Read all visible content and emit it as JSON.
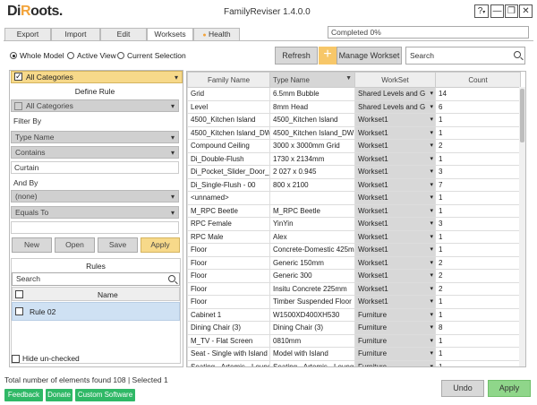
{
  "app": {
    "logo": "DiRoots",
    "title": "FamilyReviser 1.4.0.0"
  },
  "window_controls": {
    "help": "?",
    "minimize": "—",
    "restore": "❐",
    "close": "✕"
  },
  "tabs": [
    {
      "label": "Export"
    },
    {
      "label": "Import"
    },
    {
      "label": "Edit"
    },
    {
      "label": "Worksets"
    },
    {
      "label": "Health"
    }
  ],
  "progress": {
    "text": "Completed 0%",
    "value": 0
  },
  "scope": {
    "options": [
      "Whole Model",
      "Active View",
      "Current Selection"
    ],
    "selected": "Whole Model"
  },
  "toolbar": {
    "refresh": "Refresh",
    "manage_workset": "Manage Workset",
    "search_placeholder": "Search"
  },
  "left": {
    "category_filter": "All Categories",
    "define_rule_title": "Define Rule",
    "rule_category": "All Categories",
    "filter_by_label": "Filter By",
    "filter_by_value": "Type Name",
    "operator_value": "Contains",
    "filter_text": "Curtain",
    "and_by_label": "And By",
    "and_by_value": "(none)",
    "operator2_value": "Equals To",
    "buttons": {
      "new": "New",
      "open": "Open",
      "save": "Save",
      "apply": "Apply"
    },
    "rules_title": "Rules",
    "rules_search_placeholder": "Search",
    "rules_name_header": "Name",
    "rules": [
      {
        "name": "Rule 02"
      }
    ],
    "hide_unchecked": "Hide un-checked"
  },
  "grid": {
    "headers": [
      "Family Name",
      "Type Name",
      "WorkSet",
      "Count"
    ],
    "rows": [
      [
        "Grid",
        "6.5mm Bubble",
        "Shared Levels and G",
        "14"
      ],
      [
        "Level",
        "8mm Head",
        "Shared Levels and G",
        "6"
      ],
      [
        "4500_Kitchen Island",
        "4500_Kitchen Island",
        "Workset1",
        "1"
      ],
      [
        "4500_Kitchen Island_DW",
        "4500_Kitchen Island_DW",
        "Workset1",
        "1"
      ],
      [
        "Compound Ceiling",
        "3000 x 3000mm Grid",
        "Workset1",
        "2"
      ],
      [
        "Di_Double-Flush",
        "1730 x 2134mm",
        "Workset1",
        "1"
      ],
      [
        "Di_Pocket_Slider_Door_5l",
        "2 027 x 0.945",
        "Workset1",
        "3"
      ],
      [
        "Di_Single-Flush - 00",
        "800 x 2100",
        "Workset1",
        "7"
      ],
      [
        "<unnamed>",
        "",
        "Workset1",
        "1"
      ],
      [
        "M_RPC Beetle",
        "M_RPC Beetle",
        "Workset1",
        "1"
      ],
      [
        "RPC Female",
        "YinYin",
        "Workset1",
        "3"
      ],
      [
        "RPC Male",
        "Alex",
        "Workset1",
        "1"
      ],
      [
        "Floor",
        "Concrete-Domestic 425m",
        "Workset1",
        "1"
      ],
      [
        "Floor",
        "Generic 150mm",
        "Workset1",
        "2"
      ],
      [
        "Floor",
        "Generic 300",
        "Workset1",
        "2"
      ],
      [
        "Floor",
        "Insitu Concrete 225mm",
        "Workset1",
        "2"
      ],
      [
        "Floor",
        "Timber Suspended Floor",
        "Workset1",
        "1"
      ],
      [
        "Cabinet 1",
        "W1500XD400XH530",
        "Furniture",
        "1"
      ],
      [
        "Dining Chair (3)",
        "Dining Chair (3)",
        "Furniture",
        "8"
      ],
      [
        "M_TV - Flat Screen",
        "0810mm",
        "Furniture",
        "1"
      ],
      [
        "Seat - Single with Island",
        "Model with Island",
        "Furniture",
        "1"
      ],
      [
        "Seating - Artemis - Loung",
        "Seating - Artemis - Loung",
        "Furniture",
        "1"
      ]
    ]
  },
  "status": "Total number of elements found 108 | Selected 1",
  "footer": {
    "feedback": "Feedback",
    "donate": "Donate",
    "custom_software": "Custom Software",
    "undo": "Undo",
    "apply": "Apply"
  }
}
